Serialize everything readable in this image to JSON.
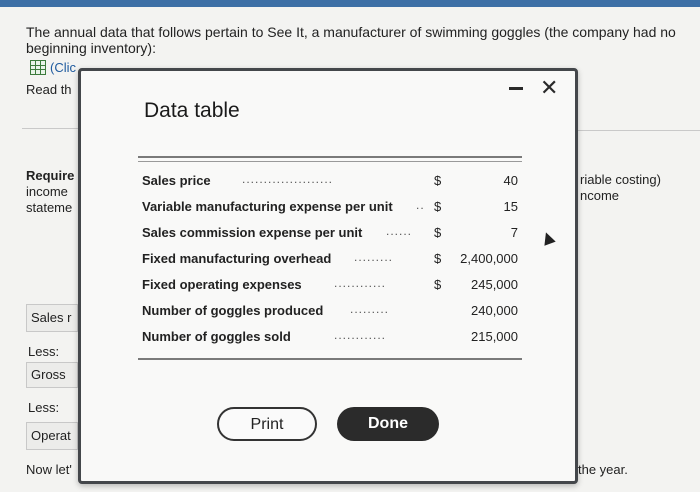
{
  "intro": "The annual data that follows pertain to See It, a manufacturer of swimming goggles (the company had no beginning inventory):",
  "clip_label": "(Clic",
  "background": {
    "read": "Read th",
    "require1": "Require",
    "require2": "income",
    "require3": "stateme",
    "right1": "riable costing)",
    "right2": "ncome",
    "sales": "Sales r",
    "less1": "Less:",
    "gross": "Gross",
    "less2": "Less:",
    "operat": "Operat",
    "now_let": "Now let'",
    "the_year": "the year."
  },
  "modal": {
    "title": "Data table",
    "minimize_icon": "minimize-icon",
    "close_glyph": "✕",
    "rows": [
      {
        "label": "Sales price",
        "currency": "$",
        "value": "40"
      },
      {
        "label": "Variable manufacturing expense per unit",
        "currency": "$",
        "value": "15"
      },
      {
        "label": "Sales commission expense per unit",
        "currency": "$",
        "value": "7"
      },
      {
        "label": "Fixed manufacturing overhead",
        "currency": "$",
        "value": "2,400,000"
      },
      {
        "label": "Fixed operating expenses",
        "currency": "$",
        "value": "245,000"
      },
      {
        "label": "Number of goggles produced",
        "currency": "",
        "value": "240,000"
      },
      {
        "label": "Number of goggles sold",
        "currency": "",
        "value": "215,000"
      }
    ],
    "print_label": "Print",
    "done_label": "Done"
  }
}
